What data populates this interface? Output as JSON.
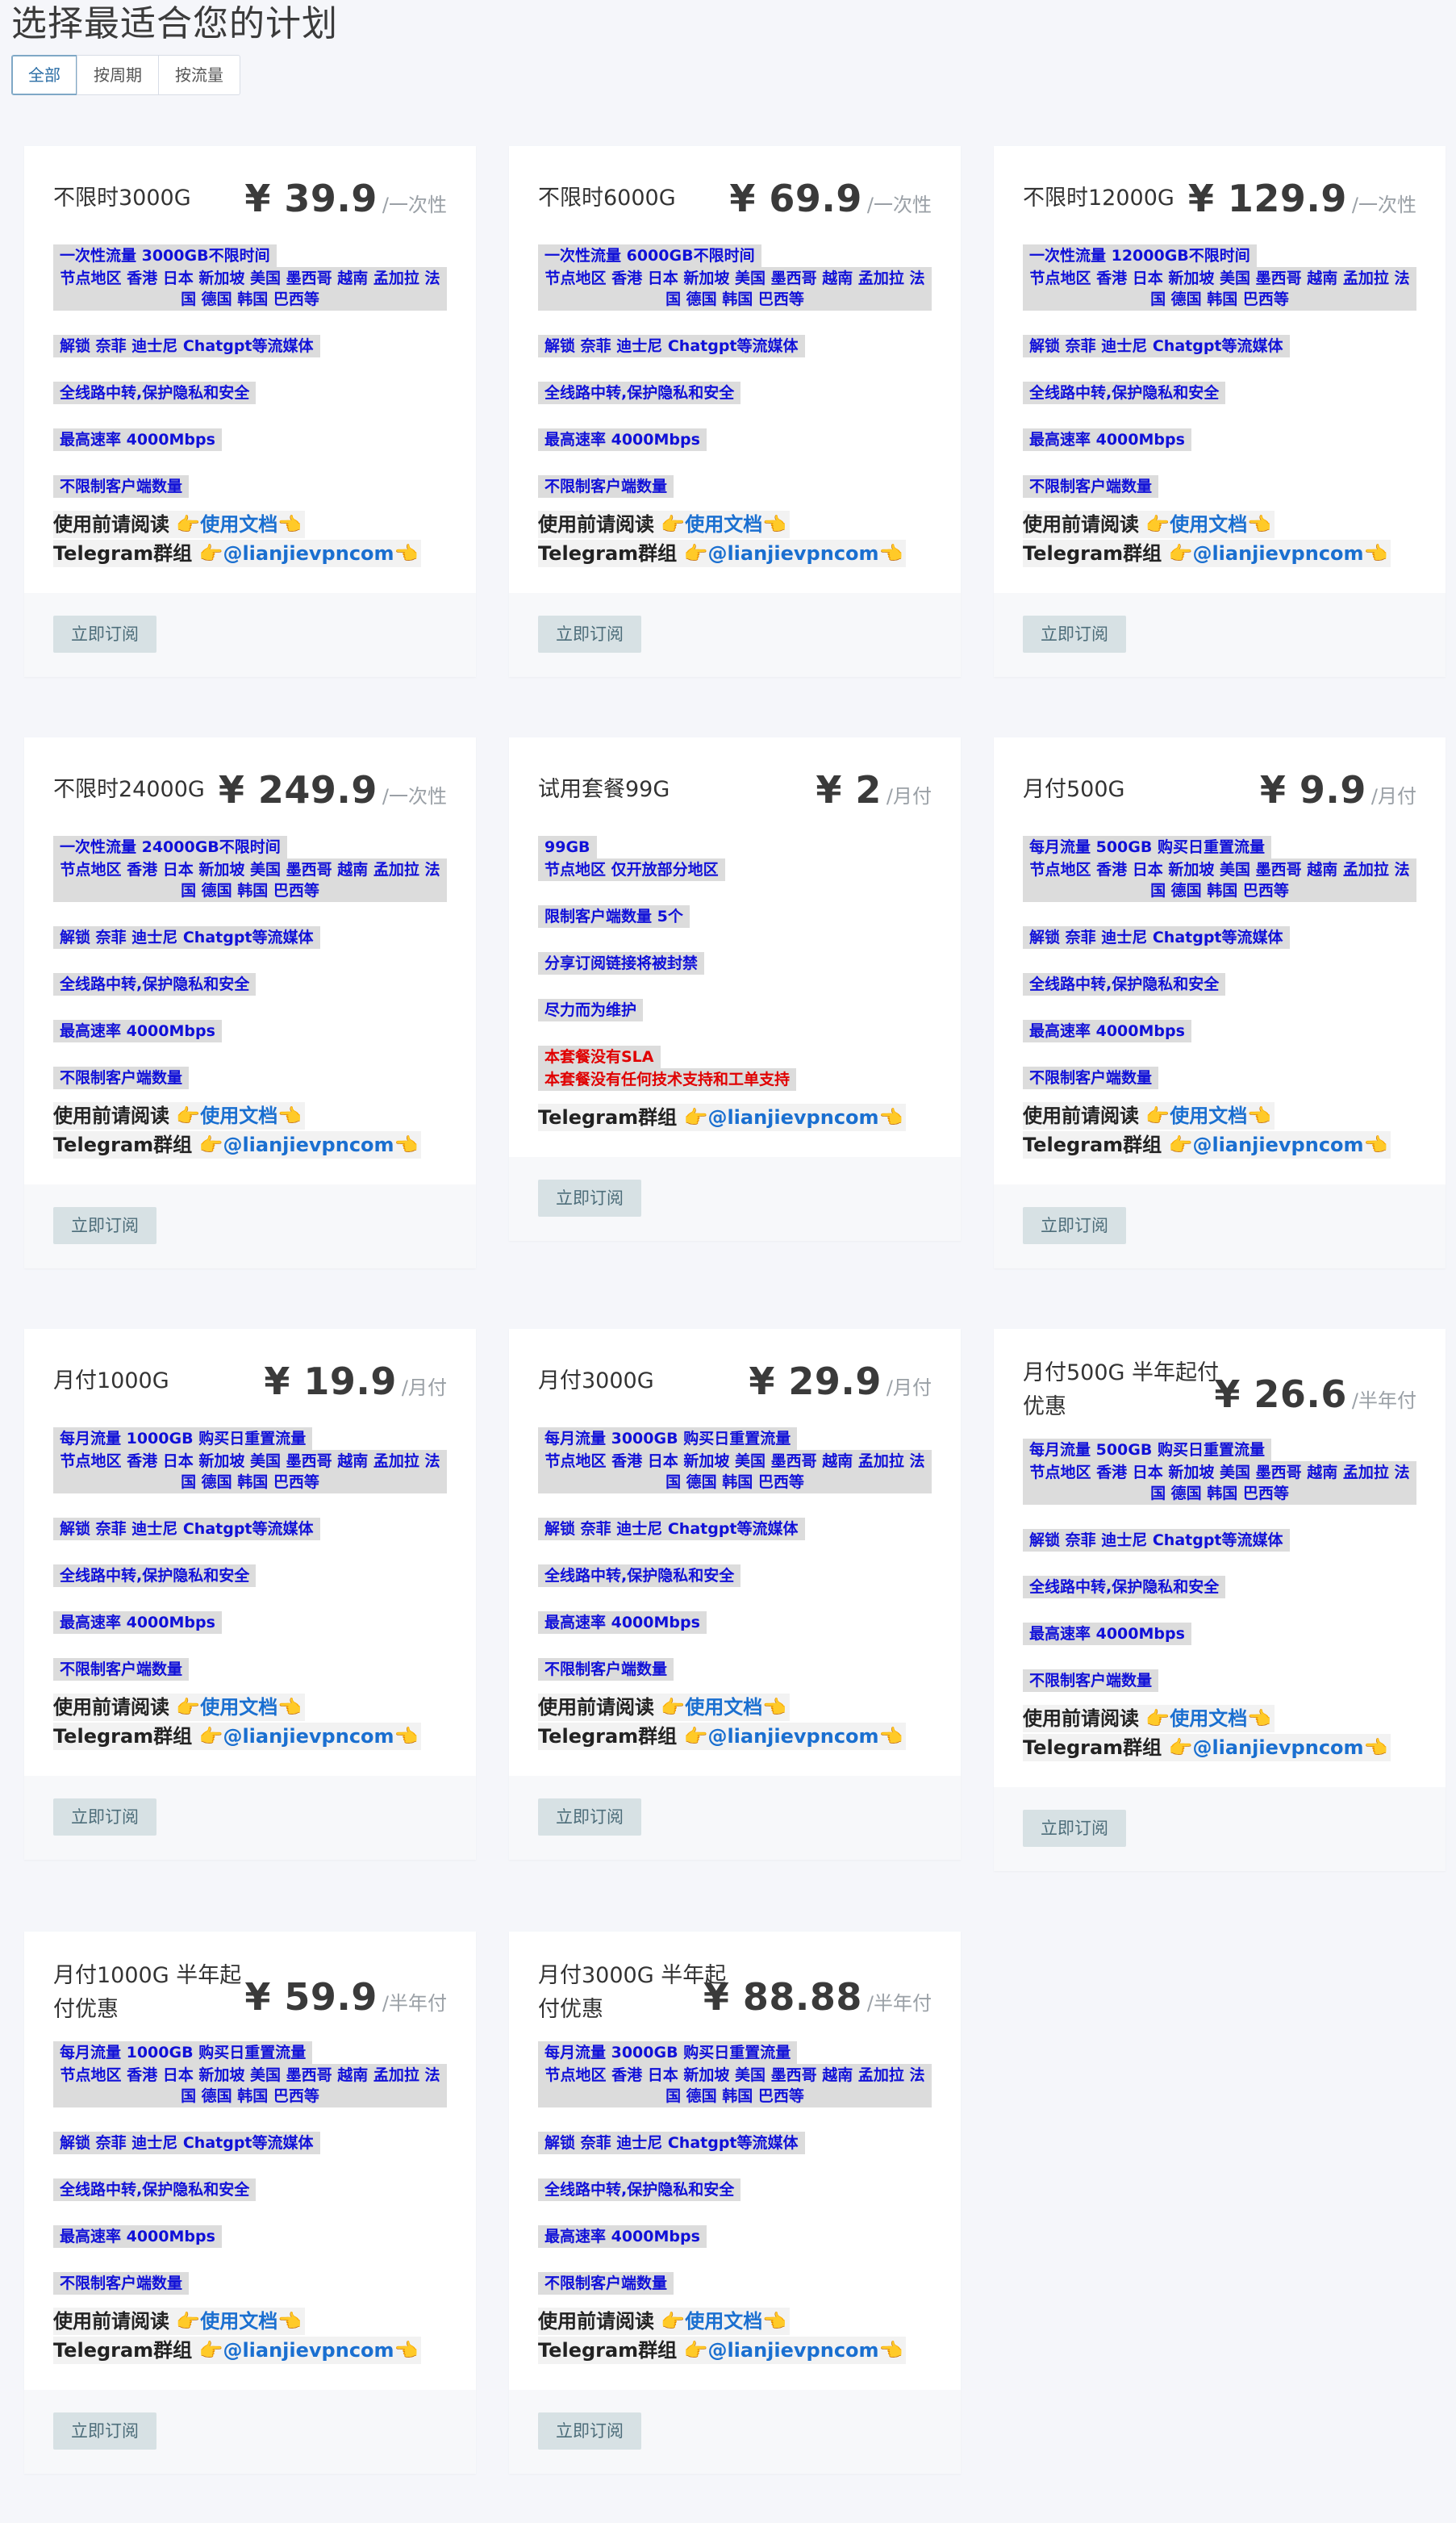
{
  "page": {
    "title": "选择最适合您的计划"
  },
  "tabs": [
    "全部",
    "按周期",
    "按流量"
  ],
  "common": {
    "docs_prefix": "使用前请阅读",
    "docs_link": "使用文档",
    "tg_prefix": "Telegram群组",
    "tg_link": "@lianjievpncom",
    "point_right": "👉",
    "point_left": "👈",
    "subscribe": "立即订阅"
  },
  "plans": [
    {
      "name": "不限时3000G",
      "price": "¥ 39.9",
      "period": "/一次性",
      "line1": "一次性流量 3000GB不限时间",
      "nodes": "节点地区 香港 日本 新加坡 美国 墨西哥 越南 孟加拉 法国 德国 韩国 巴西等",
      "unlock": "解锁 奈菲 迪士尼 Chatgpt等流媒体",
      "relay": "全线路中转,保护隐私和安全",
      "speed": "最高速率 4000Mbps",
      "clients": "不限制客户端数量"
    },
    {
      "name": "不限时6000G",
      "price": "¥ 69.9",
      "period": "/一次性",
      "line1": "一次性流量 6000GB不限时间",
      "nodes": "节点地区 香港 日本 新加坡 美国 墨西哥 越南 孟加拉 法国 德国 韩国 巴西等",
      "unlock": "解锁 奈菲 迪士尼 Chatgpt等流媒体",
      "relay": "全线路中转,保护隐私和安全",
      "speed": "最高速率 4000Mbps",
      "clients": "不限制客户端数量"
    },
    {
      "name": "不限时12000G",
      "price": "¥ 129.9",
      "period": "/一次性",
      "line1": "一次性流量 12000GB不限时间",
      "nodes": "节点地区 香港 日本 新加坡 美国 墨西哥 越南 孟加拉 法国 德国 韩国 巴西等",
      "unlock": "解锁 奈菲 迪士尼 Chatgpt等流媒体",
      "relay": "全线路中转,保护隐私和安全",
      "speed": "最高速率 4000Mbps",
      "clients": "不限制客户端数量"
    },
    {
      "name": "不限时24000G",
      "price": "¥ 249.9",
      "period": "/一次性",
      "line1": "一次性流量 24000GB不限时间",
      "nodes": "节点地区 香港 日本 新加坡 美国 墨西哥 越南 孟加拉 法国 德国 韩国 巴西等",
      "unlock": "解锁 奈菲 迪士尼 Chatgpt等流媒体",
      "relay": "全线路中转,保护隐私和安全",
      "speed": "最高速率 4000Mbps",
      "clients": "不限制客户端数量"
    },
    {
      "name": "试用套餐99G",
      "price": "¥ 2",
      "period": "/月付",
      "trial": {
        "traffic": "99GB",
        "nodes": "节点地区 仅开放部分地区",
        "clients": "限制客户端数量 5个",
        "share": "分享订阅链接将被封禁",
        "maintain": "尽力而为维护",
        "no_sla": "本套餐没有SLA",
        "no_support": "本套餐没有任何技术支持和工单支持"
      }
    },
    {
      "name": "月付500G",
      "price": "¥ 9.9",
      "period": "/月付",
      "line1": "每月流量 500GB 购买日重置流量",
      "nodes": "节点地区 香港 日本 新加坡 美国 墨西哥 越南 孟加拉 法国 德国 韩国 巴西等",
      "unlock": "解锁 奈菲 迪士尼 Chatgpt等流媒体",
      "relay": "全线路中转,保护隐私和安全",
      "speed": "最高速率 4000Mbps",
      "clients": "不限制客户端数量"
    },
    {
      "name": "月付1000G",
      "price": "¥ 19.9",
      "period": "/月付",
      "line1": "每月流量 1000GB 购买日重置流量",
      "nodes": "节点地区 香港 日本 新加坡 美国 墨西哥 越南 孟加拉 法国 德国 韩国 巴西等",
      "unlock": "解锁 奈菲 迪士尼 Chatgpt等流媒体",
      "relay": "全线路中转,保护隐私和安全",
      "speed": "最高速率 4000Mbps",
      "clients": "不限制客户端数量"
    },
    {
      "name": "月付3000G",
      "price": "¥ 29.9",
      "period": "/月付",
      "line1": "每月流量 3000GB 购买日重置流量",
      "nodes": "节点地区 香港 日本 新加坡 美国 墨西哥 越南 孟加拉 法国 德国 韩国 巴西等",
      "unlock": "解锁 奈菲 迪士尼 Chatgpt等流媒体",
      "relay": "全线路中转,保护隐私和安全",
      "speed": "最高速率 4000Mbps",
      "clients": "不限制客户端数量"
    },
    {
      "name": "月付500G 半年起付优惠",
      "price": "¥ 26.6",
      "period": "/半年付",
      "line1": "每月流量 500GB 购买日重置流量",
      "nodes": "节点地区 香港 日本 新加坡 美国 墨西哥 越南 孟加拉 法国 德国 韩国 巴西等",
      "unlock": "解锁 奈菲 迪士尼 Chatgpt等流媒体",
      "relay": "全线路中转,保护隐私和安全",
      "speed": "最高速率 4000Mbps",
      "clients": "不限制客户端数量"
    },
    {
      "name": "月付1000G 半年起付优惠",
      "price": "¥ 59.9",
      "period": "/半年付",
      "line1": "每月流量 1000GB 购买日重置流量",
      "nodes": "节点地区 香港 日本 新加坡 美国 墨西哥 越南 孟加拉 法国 德国 韩国 巴西等",
      "unlock": "解锁 奈菲 迪士尼 Chatgpt等流媒体",
      "relay": "全线路中转,保护隐私和安全",
      "speed": "最高速率 4000Mbps",
      "clients": "不限制客户端数量"
    },
    {
      "name": "月付3000G 半年起付优惠",
      "price": "¥ 88.88",
      "period": "/半年付",
      "line1": "每月流量 3000GB 购买日重置流量",
      "nodes": "节点地区 香港 日本 新加坡 美国 墨西哥 越南 孟加拉 法国 德国 韩国 巴西等",
      "unlock": "解锁 奈菲 迪士尼 Chatgpt等流媒体",
      "relay": "全线路中转,保护隐私和安全",
      "speed": "最高速率 4000Mbps",
      "clients": "不限制客户端数量"
    }
  ]
}
